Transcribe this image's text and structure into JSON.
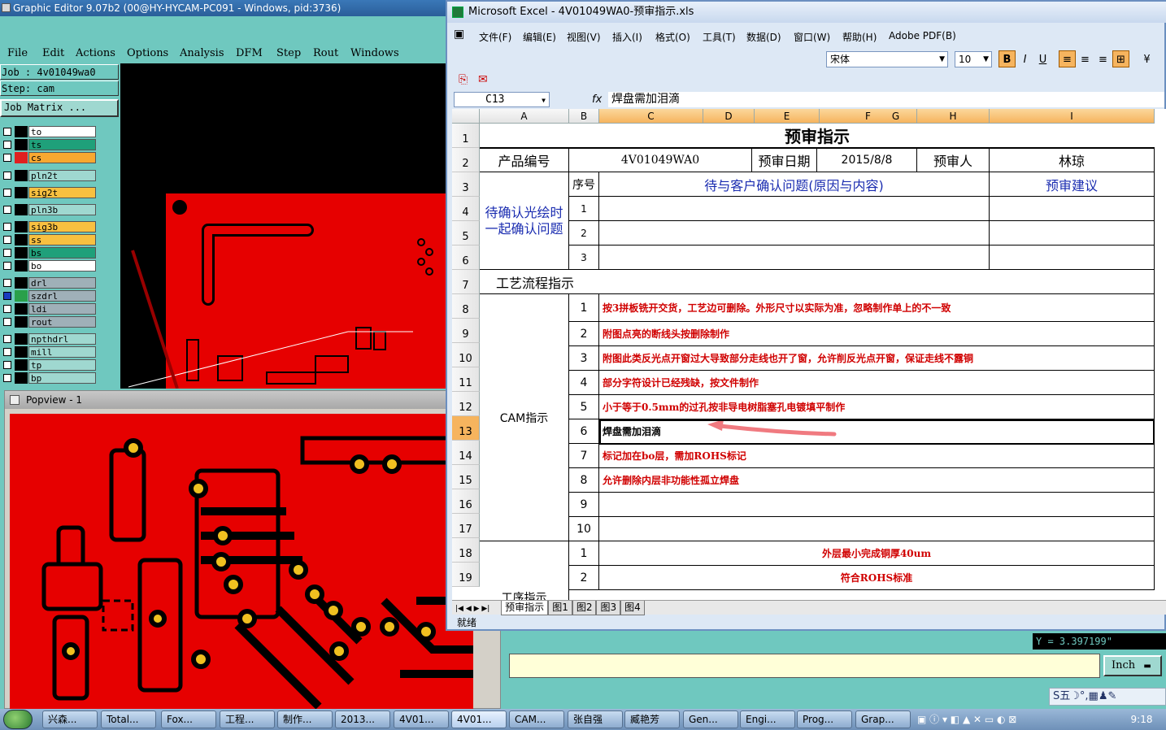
{
  "graphic_editor": {
    "title": "Graphic Editor 9.07b2 (00@HY-HYCAM-PC091 - Windows, pid:3736)",
    "menu": [
      "File",
      "Edit",
      "Actions",
      "Options",
      "Analysis",
      "DFM",
      "Step",
      "Rout",
      "Windows"
    ],
    "job_label": "Job : 4v01049wa0",
    "step_label": "Step: cam",
    "job_matrix_button": "Job Matrix ...",
    "layers": [
      {
        "name": "to",
        "color": "#ffffff",
        "swatch": "#000000",
        "checked": false
      },
      {
        "name": "ts",
        "color": "#1fa07a",
        "swatch": "#000000",
        "checked": false
      },
      {
        "name": "cs",
        "color": "#f8a830",
        "swatch": "#e02020",
        "checked": false
      },
      {
        "name": "pln2t",
        "color": "#9fd8d0",
        "swatch": "#000000",
        "checked": false
      },
      {
        "name": "sig2t",
        "color": "#f8c040",
        "swatch": "#000000",
        "checked": false
      },
      {
        "name": "pln3b",
        "color": "#9fd8d0",
        "swatch": "#000000",
        "checked": false
      },
      {
        "name": "sig3b",
        "color": "#f8c040",
        "swatch": "#000000",
        "checked": false
      },
      {
        "name": "ss",
        "color": "#f8c040",
        "swatch": "#000000",
        "checked": false
      },
      {
        "name": "bs",
        "color": "#1fa07a",
        "swatch": "#000000",
        "checked": false
      },
      {
        "name": "bo",
        "color": "#ffffff",
        "swatch": "#000000",
        "checked": false
      },
      {
        "name": "drl",
        "color": "#9fb0b8",
        "swatch": "#000000",
        "checked": false
      },
      {
        "name": "szdrl",
        "color": "#9fb0b8",
        "swatch": "#2aa04a",
        "checked": true
      },
      {
        "name": "ldi",
        "color": "#9fb0b8",
        "swatch": "#000000",
        "checked": false
      },
      {
        "name": "rout",
        "color": "#9fb0b8",
        "swatch": "#000000",
        "checked": false
      },
      {
        "name": "npthdrl",
        "color": "#9fd8d0",
        "swatch": "#000000",
        "checked": false
      },
      {
        "name": "mill",
        "color": "#9fd8d0",
        "swatch": "#000000",
        "checked": false
      },
      {
        "name": "tp",
        "color": "#9fd8d0",
        "swatch": "#000000",
        "checked": false
      },
      {
        "name": "bp",
        "color": "#9fd8d0",
        "swatch": "#000000",
        "checked": false
      }
    ],
    "coord_readout": "Y = 3.397199\"",
    "units_button": "Inch",
    "ime_bar": "S五☽°,▦♟✎"
  },
  "popview": {
    "title": "Popview - 1"
  },
  "excel": {
    "title": "Microsoft Excel - 4V01049WA0-预审指示.xls",
    "menu": [
      "文件(F)",
      "编辑(E)",
      "视图(V)",
      "插入(I)",
      "格式(O)",
      "工具(T)",
      "数据(D)",
      "窗口(W)",
      "帮助(H)",
      "Adobe PDF(B)"
    ],
    "font_name": "宋体",
    "font_size": "10",
    "name_box": "C13",
    "formula": "焊盘需加泪滴",
    "columns": [
      "A",
      "B",
      "C",
      "D",
      "E",
      "F",
      "G",
      "H",
      "I"
    ],
    "rows": [
      "1",
      "2",
      "3",
      "4",
      "5",
      "6",
      "7",
      "8",
      "9",
      "10",
      "11",
      "12",
      "13",
      "14",
      "15",
      "16",
      "17",
      "18",
      "19"
    ],
    "sheet": {
      "title": "预审指示",
      "product_no_label": "产品编号",
      "product_no": "4V01049WA0",
      "review_date_label": "预审日期",
      "review_date": "2015/8/8",
      "reviewer_label": "预审人",
      "reviewer": "林琼",
      "seq_label": "序号",
      "issue_header": "待与客户确认问题(原因与内容)",
      "advice_header": "预审建议",
      "confirm_group": "待确认光绘时一起确认问题",
      "confirm_nums": [
        "1",
        "2",
        "3"
      ],
      "process_label": "工艺流程指示",
      "cam_label": "CAM指示",
      "cam_items": [
        {
          "n": "1",
          "text": "按3拼板铣开交货，工艺边可删除。外形尺寸以实际为准，忽略制作单上的不一致"
        },
        {
          "n": "2",
          "text": "附图点亮的断线头按删除制作"
        },
        {
          "n": "3",
          "text": "附图此类反光点开窗过大导致部分走线也开了窗，允许削反光点开窗，保证走线不露铜"
        },
        {
          "n": "4",
          "text": "部分字符设计已经残缺，按文件制作"
        },
        {
          "n": "5",
          "text": "小于等于0.5mm的过孔按非导电树脂塞孔电镀填平制作"
        },
        {
          "n": "6",
          "text": "焊盘需加泪滴"
        },
        {
          "n": "7",
          "text": "标记加在bo层，需加ROHS标记"
        },
        {
          "n": "8",
          "text": "允许删除内层非功能性孤立焊盘"
        },
        {
          "n": "9",
          "text": ""
        },
        {
          "n": "10",
          "text": ""
        }
      ],
      "engineering_label": "工序指示",
      "eng_items": [
        {
          "n": "1",
          "text": "外层最小完成铜厚40um"
        },
        {
          "n": "2",
          "text": "符合ROHS标准"
        }
      ]
    },
    "tabs": [
      "预审指示",
      "图1",
      "图2",
      "图3",
      "图4"
    ],
    "status": "就绪"
  },
  "taskbar": {
    "tasks": [
      "兴森...",
      "Total...",
      "Fox...",
      "工程...",
      "制作...",
      "2013...",
      "4V01...",
      "4V01...",
      "CAM...",
      "张自强",
      "臧艳芳",
      "Gen...",
      "Engi...",
      "Prog...",
      "Grap..."
    ],
    "clock": "9:18"
  }
}
